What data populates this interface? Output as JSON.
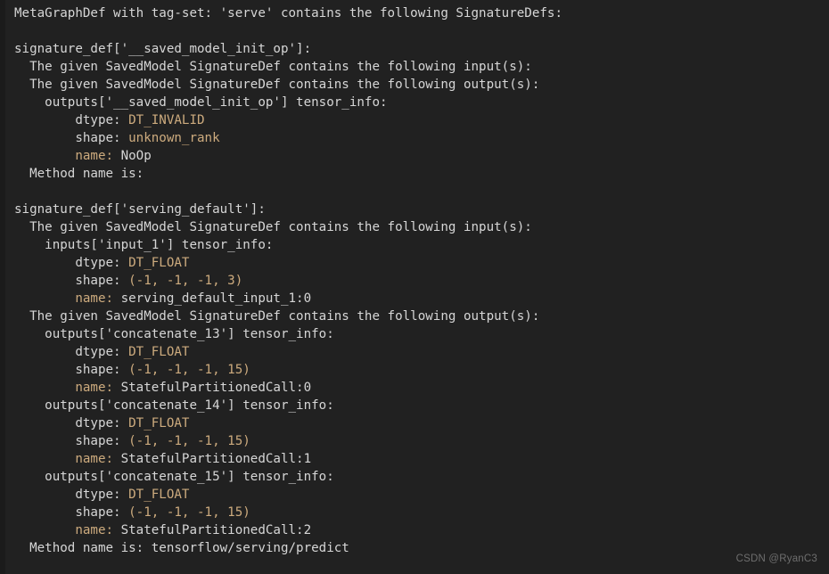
{
  "terminal": {
    "background_color": "#212121",
    "gutter_color": "#1b1b1b",
    "text_color": "#d6d6d6",
    "value_color": "#cdab7e",
    "watermark_color": "#6e6e6e"
  },
  "watermark": {
    "text": "CSDN @RyanC3"
  },
  "output": {
    "header": "MetaGraphDef with tag-set: 'serve' contains the following SignatureDefs:",
    "blank": "",
    "lines": [
      {
        "text": "MetaGraphDef with tag-set: 'serve' contains the following SignatureDefs:"
      },
      {
        "text": ""
      },
      {
        "text": "signature_def['__saved_model_init_op']:"
      },
      {
        "text": "  The given SavedModel SignatureDef contains the following input(s):"
      },
      {
        "text": "  The given SavedModel SignatureDef contains the following output(s):"
      },
      {
        "text": "    outputs['__saved_model_init_op'] tensor_info:"
      },
      {
        "text": "        dtype: ",
        "value": "DT_INVALID"
      },
      {
        "text": "        shape: ",
        "value": "unknown_rank"
      },
      {
        "text": "        ",
        "label": "name: ",
        "tail": "NoOp"
      },
      {
        "text": "  Method name is:"
      },
      {
        "text": ""
      },
      {
        "text": "signature_def['serving_default']:"
      },
      {
        "text": "  The given SavedModel SignatureDef contains the following input(s):"
      },
      {
        "text": "    inputs['input_1'] tensor_info:"
      },
      {
        "text": "        dtype: ",
        "value": "DT_FLOAT"
      },
      {
        "text": "        shape: ",
        "value": "(-1, -1, -1, 3)"
      },
      {
        "text": "        ",
        "label": "name: ",
        "tail": "serving_default_input_1:0"
      },
      {
        "text": "  The given SavedModel SignatureDef contains the following output(s):"
      },
      {
        "text": "    outputs['concatenate_13'] tensor_info:"
      },
      {
        "text": "        dtype: ",
        "value": "DT_FLOAT"
      },
      {
        "text": "        shape: ",
        "value": "(-1, -1, -1, 15)"
      },
      {
        "text": "        ",
        "label": "name: ",
        "tail": "StatefulPartitionedCall:0"
      },
      {
        "text": "    outputs['concatenate_14'] tensor_info:"
      },
      {
        "text": "        dtype: ",
        "value": "DT_FLOAT"
      },
      {
        "text": "        shape: ",
        "value": "(-1, -1, -1, 15)"
      },
      {
        "text": "        ",
        "label": "name: ",
        "tail": "StatefulPartitionedCall:1"
      },
      {
        "text": "    outputs['concatenate_15'] tensor_info:"
      },
      {
        "text": "        dtype: ",
        "value": "DT_FLOAT"
      },
      {
        "text": "        shape: ",
        "value": "(-1, -1, -1, 15)"
      },
      {
        "text": "        ",
        "label": "name: ",
        "tail": "StatefulPartitionedCall:2"
      },
      {
        "text": "  Method name is: tensorflow/serving/predict"
      }
    ],
    "signature_defs": [
      {
        "key": "__saved_model_init_op",
        "inputs": [],
        "outputs": [
          {
            "key": "__saved_model_init_op",
            "dtype": "DT_INVALID",
            "shape": "unknown_rank",
            "name": "NoOp"
          }
        ],
        "method_name": ""
      },
      {
        "key": "serving_default",
        "inputs": [
          {
            "key": "input_1",
            "dtype": "DT_FLOAT",
            "shape": "(-1, -1, -1, 3)",
            "name": "serving_default_input_1:0"
          }
        ],
        "outputs": [
          {
            "key": "concatenate_13",
            "dtype": "DT_FLOAT",
            "shape": "(-1, -1, -1, 15)",
            "name": "StatefulPartitionedCall:0"
          },
          {
            "key": "concatenate_14",
            "dtype": "DT_FLOAT",
            "shape": "(-1, -1, -1, 15)",
            "name": "StatefulPartitionedCall:1"
          },
          {
            "key": "concatenate_15",
            "dtype": "DT_FLOAT",
            "shape": "(-1, -1, -1, 15)",
            "name": "StatefulPartitionedCall:2"
          }
        ],
        "method_name": "tensorflow/serving/predict"
      }
    ]
  }
}
